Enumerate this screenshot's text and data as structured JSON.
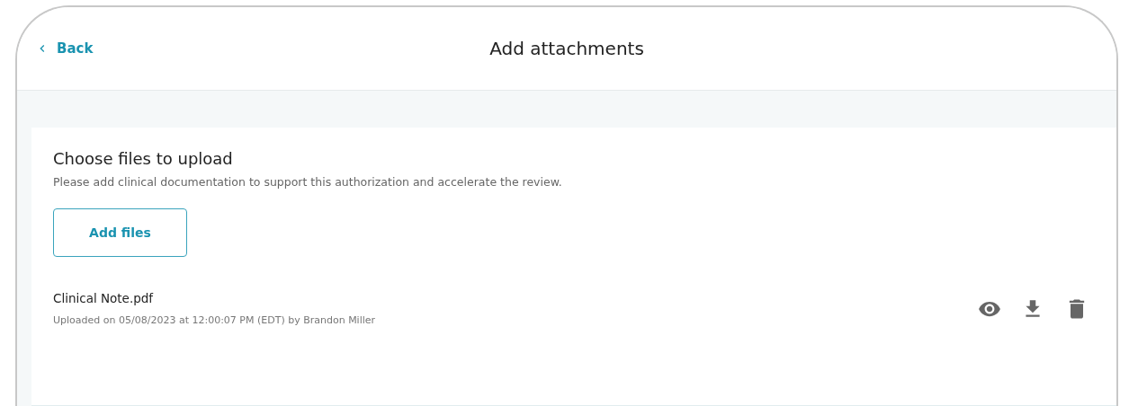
{
  "header": {
    "back": "Back",
    "title": "Add attachments"
  },
  "upload": {
    "title": "Choose files to upload",
    "description": "Please add clinical documentation to support this authorization and accelerate the review.",
    "button": "Add files"
  },
  "files": [
    {
      "name": "Clinical Note.pdf",
      "meta": "Uploaded on 05/08/2023 at 12:00:07 PM (EDT) by Brandon Miller"
    }
  ]
}
